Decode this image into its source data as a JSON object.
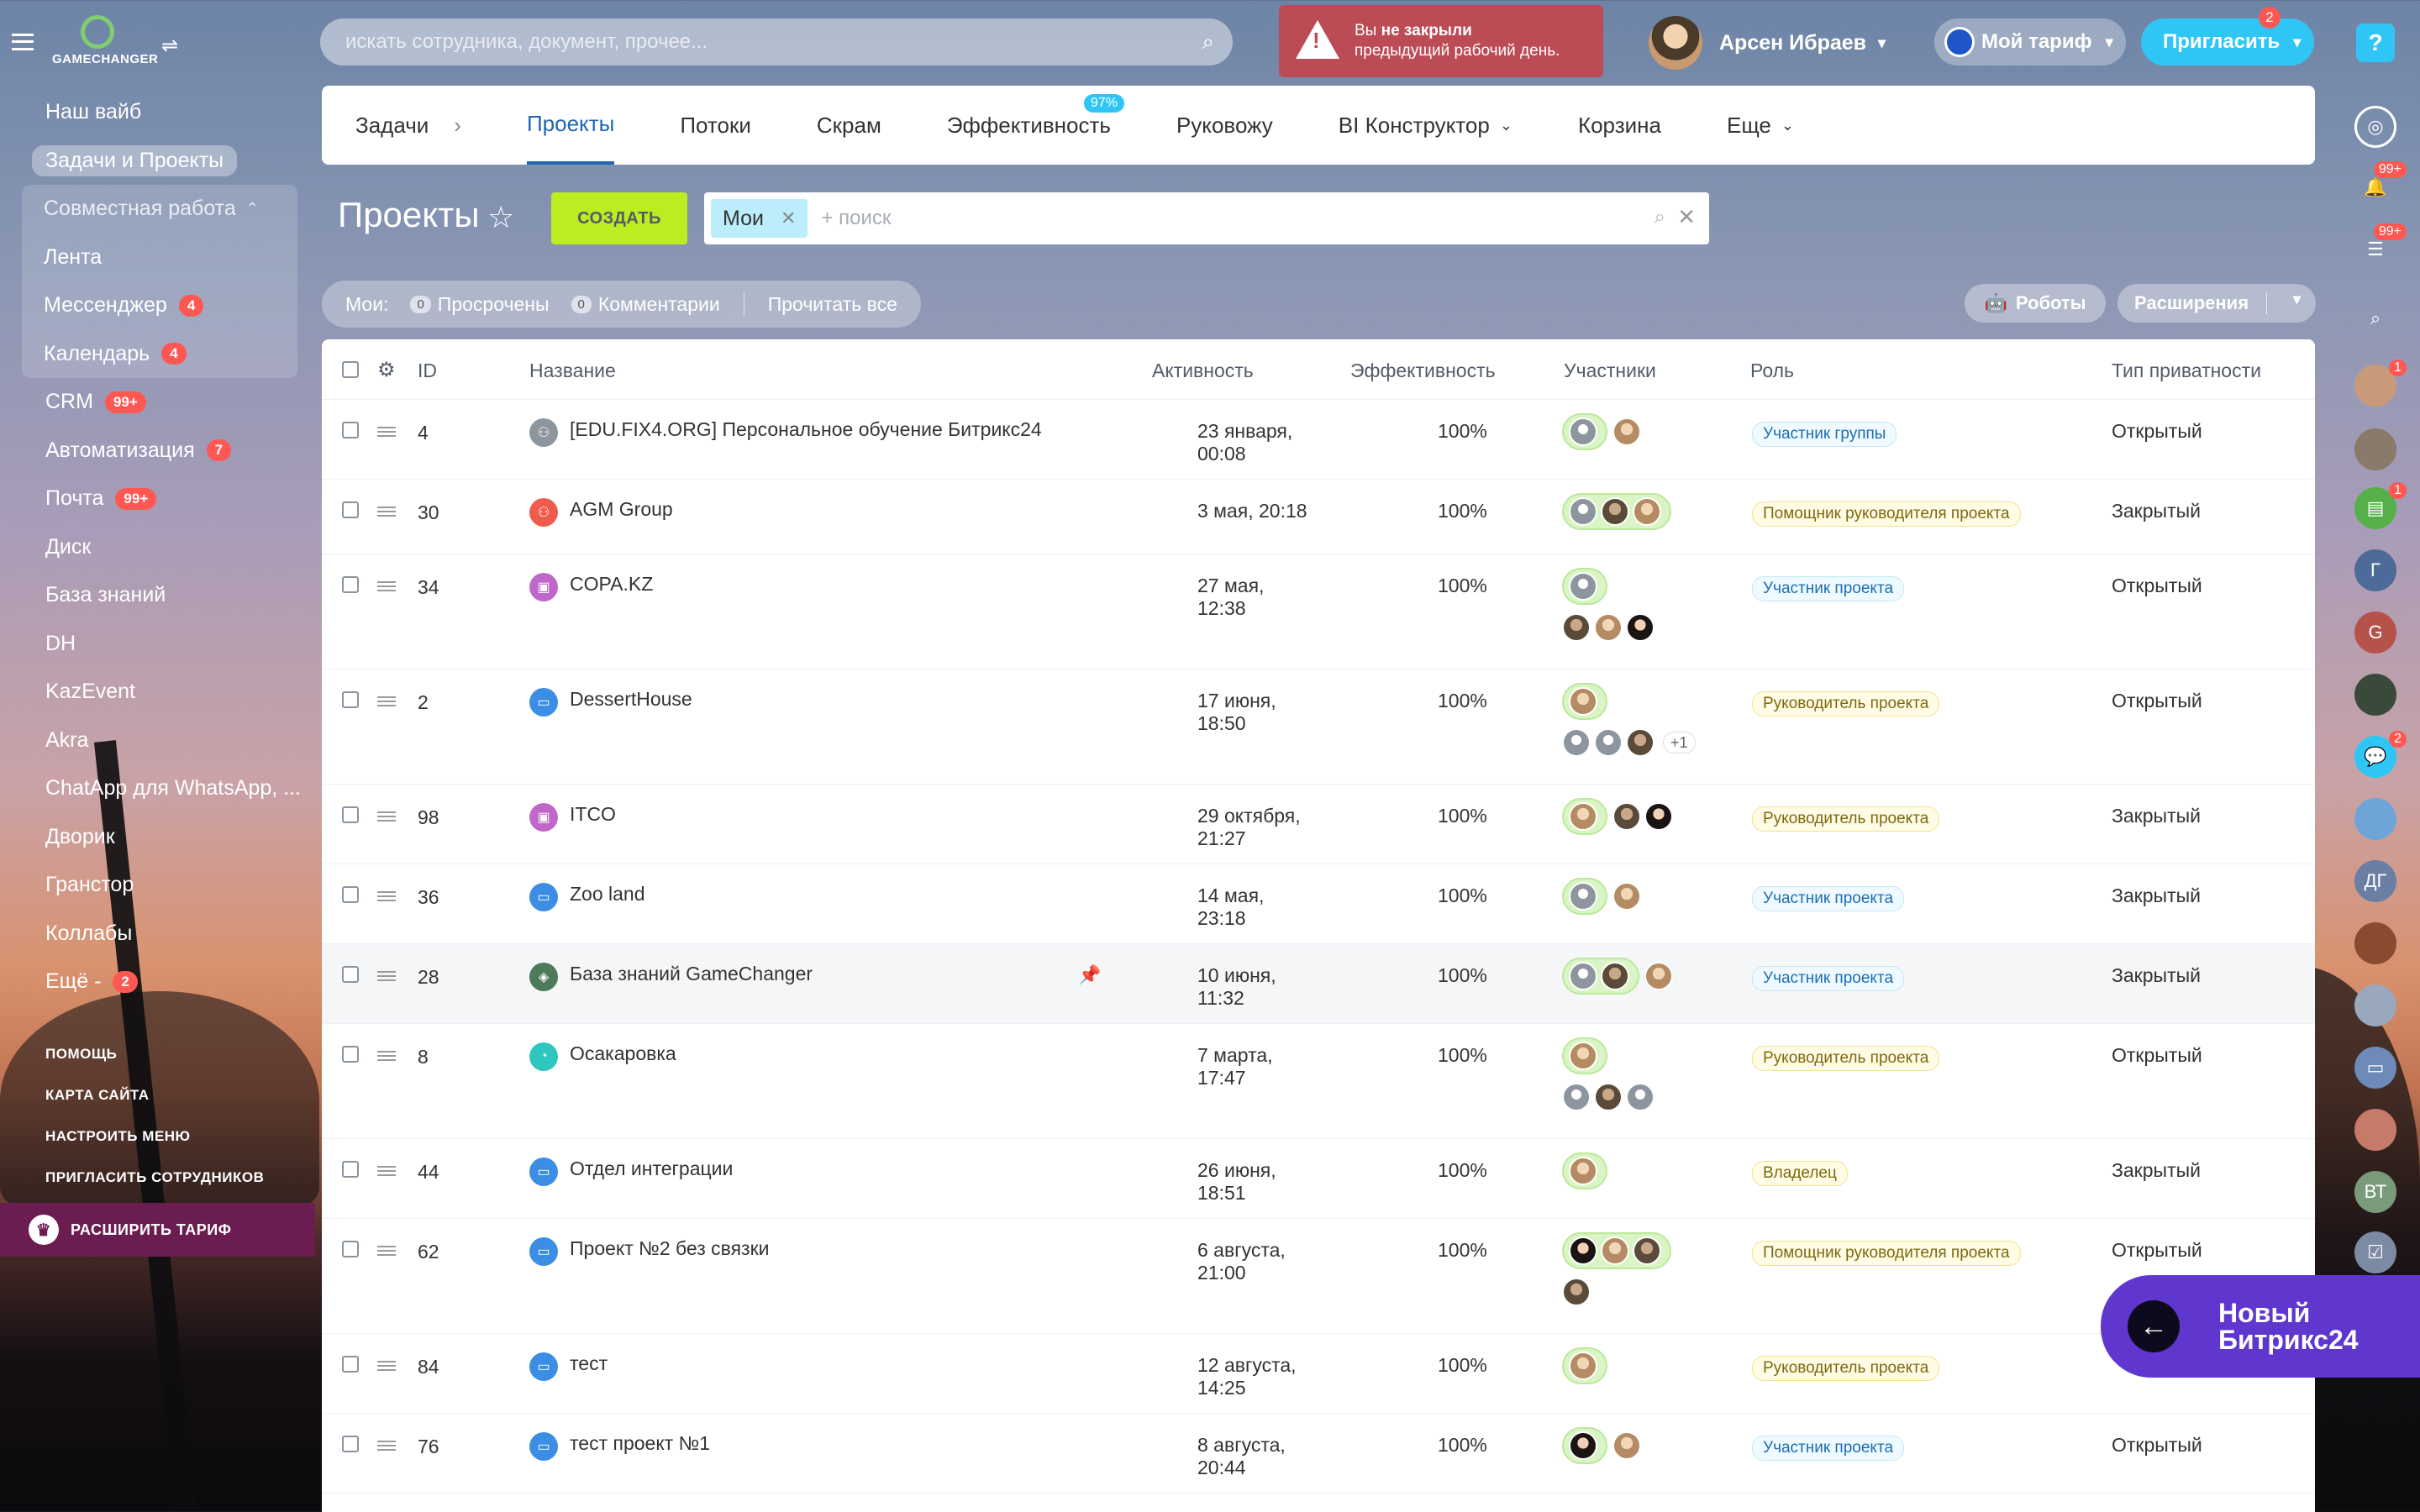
{
  "app": {
    "logo_text": "GAMECHANGER"
  },
  "sidebar": {
    "items": [
      {
        "label": "Наш вайб",
        "count": ""
      },
      {
        "label": "Задачи и Проекты",
        "count": ""
      },
      {
        "label": "Совместная работа",
        "count": ""
      },
      {
        "label": "Лента",
        "count": ""
      },
      {
        "label": "Мессенджер",
        "count": "4"
      },
      {
        "label": "Календарь",
        "count": "4"
      },
      {
        "label": "CRM",
        "count": "99+"
      },
      {
        "label": "Автоматизация",
        "count": "7"
      },
      {
        "label": "Почта",
        "count": "99+"
      },
      {
        "label": "Диск",
        "count": ""
      },
      {
        "label": "База знаний",
        "count": ""
      },
      {
        "label": "DH",
        "count": ""
      },
      {
        "label": "KazEvent",
        "count": ""
      },
      {
        "label": "Akra",
        "count": ""
      },
      {
        "label": "ChatApp для WhatsApp, ...",
        "count": ""
      },
      {
        "label": "Дворик",
        "count": ""
      },
      {
        "label": "Гранстор",
        "count": ""
      },
      {
        "label": "Коллабы",
        "count": ""
      },
      {
        "label": "Ещё -",
        "count": "2"
      }
    ],
    "links": [
      "ПОМОЩЬ",
      "КАРТА САЙТА",
      "НАСТРОИТЬ МЕНЮ",
      "ПРИГЛАСИТЬ СОТРУДНИКОВ"
    ],
    "upgrade_label": "РАСШИРИТЬ ТАРИФ"
  },
  "header": {
    "search_placeholder": "искать сотрудника, документ, прочее...",
    "warning_line1_a": "Вы ",
    "warning_line1_b": "не закрыли",
    "warning_line2": "предыдущий рабочий день.",
    "user_name": "Арсен Ибраев",
    "tariff_label": "Мой тариф",
    "invite_label": "Пригласить",
    "invite_badge": "2"
  },
  "rightbar": {
    "help": "?",
    "badges": [
      "99+",
      "99+",
      "1",
      "1",
      "2"
    ],
    "initials": [
      "Г",
      "G",
      "ДГ",
      "ВТ"
    ]
  },
  "tabs": [
    {
      "label": "Задачи",
      "badge": ""
    },
    {
      "label": "Проекты",
      "badge": ""
    },
    {
      "label": "Потоки",
      "badge": ""
    },
    {
      "label": "Скрам",
      "badge": ""
    },
    {
      "label": "Эффективность",
      "badge": "97%"
    },
    {
      "label": "Руковожу",
      "badge": ""
    },
    {
      "label": "BI Конструктор",
      "badge": ""
    },
    {
      "label": "Корзина",
      "badge": ""
    },
    {
      "label": "Еще",
      "badge": ""
    }
  ],
  "toolbar": {
    "title": "Проекты",
    "create_label": "СОЗДАТЬ",
    "filter_chip": "Мои",
    "filter_placeholder": "+ поиск",
    "counters_label": "Мои:",
    "overdue_count": "0",
    "overdue_label": "Просрочены",
    "comments_count": "0",
    "comments_label": "Комментарии",
    "read_all": "Прочитать все",
    "robots_label": "Роботы",
    "extensions_label": "Расширения"
  },
  "grid": {
    "columns": [
      "ID",
      "Название",
      "Активность",
      "Эффективность",
      "Участники",
      "Роль",
      "Тип приватности"
    ],
    "rows": [
      {
        "id": "4",
        "name": "[EDU.FIX4.ORG] Персональное обучение Битрикс24",
        "act1": "23 января,",
        "act2": "00:08",
        "eff": "100%",
        "role": "Участник группы",
        "privacy": "Открытый"
      },
      {
        "id": "30",
        "name": "AGM Group",
        "act1": "3 мая, 20:18",
        "act2": "",
        "eff": "100%",
        "role": "Помощник руководителя проекта",
        "privacy": "Закрытый"
      },
      {
        "id": "34",
        "name": "COPA.KZ",
        "act1": "27 мая,",
        "act2": "12:38",
        "eff": "100%",
        "role": "Участник проекта",
        "privacy": "Открытый"
      },
      {
        "id": "2",
        "name": "DessertHouse",
        "act1": "17 июня,",
        "act2": "18:50",
        "eff": "100%",
        "role": "Руководитель проекта",
        "privacy": "Открытый",
        "more": "+1"
      },
      {
        "id": "98",
        "name": "ITCO",
        "act1": "29 октября,",
        "act2": "21:27",
        "eff": "100%",
        "role": "Руководитель проекта",
        "privacy": "Закрытый"
      },
      {
        "id": "36",
        "name": "Zoo land",
        "act1": "14 мая,",
        "act2": "23:18",
        "eff": "100%",
        "role": "Участник проекта",
        "privacy": "Закрытый"
      },
      {
        "id": "28",
        "name": "База знаний GameChanger",
        "act1": "10 июня,",
        "act2": "11:32",
        "eff": "100%",
        "role": "Участник проекта",
        "privacy": "Закрытый"
      },
      {
        "id": "8",
        "name": "Осакаровка",
        "act1": "7 марта,",
        "act2": "17:47",
        "eff": "100%",
        "role": "Руководитель проекта",
        "privacy": "Открытый"
      },
      {
        "id": "44",
        "name": "Отдел интеграции",
        "act1": "26 июня,",
        "act2": "18:51",
        "eff": "100%",
        "role": "Владелец",
        "privacy": "Закрытый"
      },
      {
        "id": "62",
        "name": "Проект №2 без связки",
        "act1": "6 августа,",
        "act2": "21:00",
        "eff": "100%",
        "role": "Помощник руководителя проекта",
        "privacy": "Открытый"
      },
      {
        "id": "84",
        "name": "тест",
        "act1": "12 августа,",
        "act2": "14:25",
        "eff": "100%",
        "role": "Руководитель проекта",
        "privacy": ""
      },
      {
        "id": "76",
        "name": "тест проект №1",
        "act1": "8 августа,",
        "act2": "20:44",
        "eff": "100%",
        "role": "Участник проекта",
        "privacy": "Открытый"
      }
    ]
  },
  "promo": {
    "line1": "Новый",
    "line2": "Битрикс24"
  }
}
